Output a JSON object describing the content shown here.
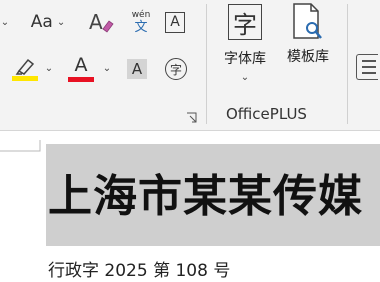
{
  "ribbon": {
    "font_size_label": "Aa",
    "pinyin_top": "wén",
    "pinyin_bottom": "文",
    "char_border_label": "A",
    "highlight_color": "#ffe600",
    "font_color_label": "A",
    "font_color": "#e81123",
    "char_shading_label": "A",
    "enclose_char_label": "字",
    "font_library_icon_char": "字",
    "font_library_label": "字体库",
    "template_library_label": "模板库",
    "group_label": "OfficePLUS"
  },
  "document": {
    "title": "上海市某某传媒",
    "doc_number": "行政字 2025 第 108 号"
  }
}
